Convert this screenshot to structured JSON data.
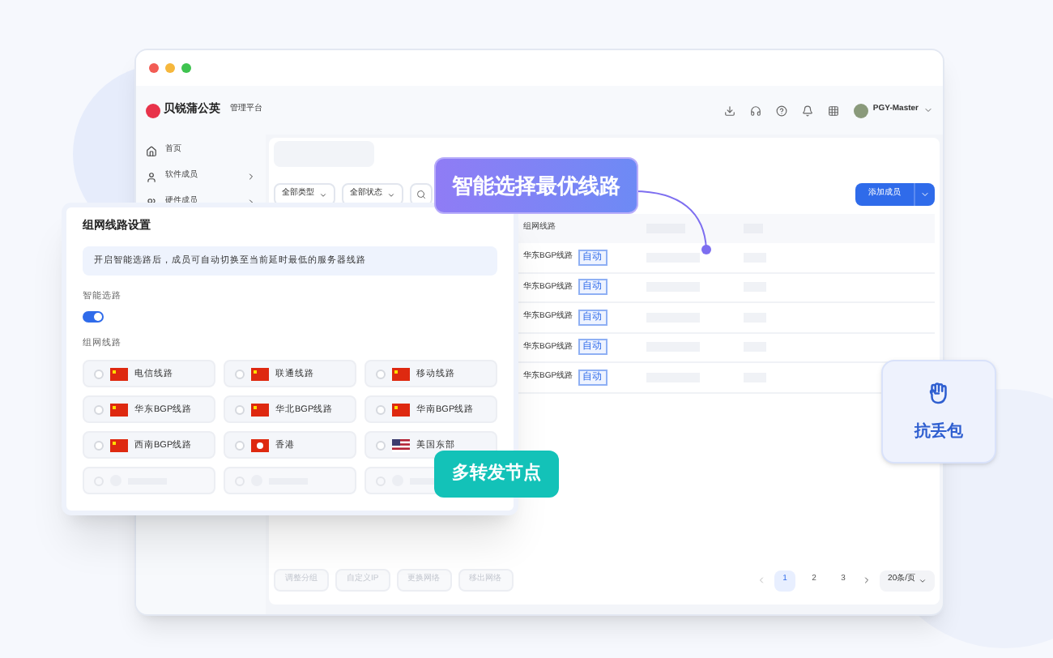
{
  "window": {
    "logo": "贝锐蒲公英",
    "subtitle": "管理平台",
    "user": "PGY-Master"
  },
  "sidebar": {
    "items": [
      {
        "label": "首页",
        "selected": false
      },
      {
        "label": "软件成员",
        "selected": false
      },
      {
        "label": "硬件成员",
        "selected": false
      }
    ]
  },
  "filters": [
    "全部类型",
    "全部状态"
  ],
  "add_button": "添加成员",
  "table": {
    "columns": [
      "组网线路"
    ],
    "rows": [
      {
        "route": "华东BGP线路",
        "tag": "自动"
      },
      {
        "route": "华东BGP线路",
        "tag": "自动"
      },
      {
        "route": "华东BGP线路",
        "tag": "自动"
      },
      {
        "route": "华东BGP线路",
        "tag": "自动"
      },
      {
        "route": "华东BGP线路",
        "tag": "自动"
      }
    ]
  },
  "bulk_actions": [
    {
      "label": "调整分组",
      "disabled": true
    },
    {
      "label": "自定义IP",
      "disabled": true
    },
    {
      "label": "更换网络",
      "disabled": true
    },
    {
      "label": "移出网络",
      "disabled": true
    }
  ],
  "pagination": {
    "pages": [
      {
        "label": "1",
        "selected": true
      },
      {
        "label": "2",
        "selected": false
      },
      {
        "label": "3",
        "selected": false
      }
    ],
    "page_size": "20条/页"
  },
  "panel": {
    "title": "组网线路设置",
    "notice": "开启智能选路后，成员可自动切换至当前延时最低的服务器线路",
    "smart_label": "智能选路",
    "smart_on": true,
    "routes_label": "组网线路",
    "routes": [
      {
        "label": "电信线路",
        "kind": "cn",
        "selected": false
      },
      {
        "label": "联通线路",
        "kind": "cn",
        "selected": false
      },
      {
        "label": "移动线路",
        "kind": "cn",
        "selected": false
      },
      {
        "label": "华东BGP线路",
        "kind": "cn",
        "selected": false
      },
      {
        "label": "华北BGP线路",
        "kind": "cn",
        "selected": false
      },
      {
        "label": "华南BGP线路",
        "kind": "cn",
        "selected": false
      },
      {
        "label": "西南BGP线路",
        "kind": "cn",
        "selected": false
      },
      {
        "label": "香港",
        "kind": "hk",
        "selected": false
      },
      {
        "label": "美国东部",
        "kind": "us",
        "selected": false
      }
    ]
  },
  "callouts": {
    "smart": "智能选择最优线路",
    "relay": "多转发节点",
    "anti_loss": "抗丢包"
  }
}
